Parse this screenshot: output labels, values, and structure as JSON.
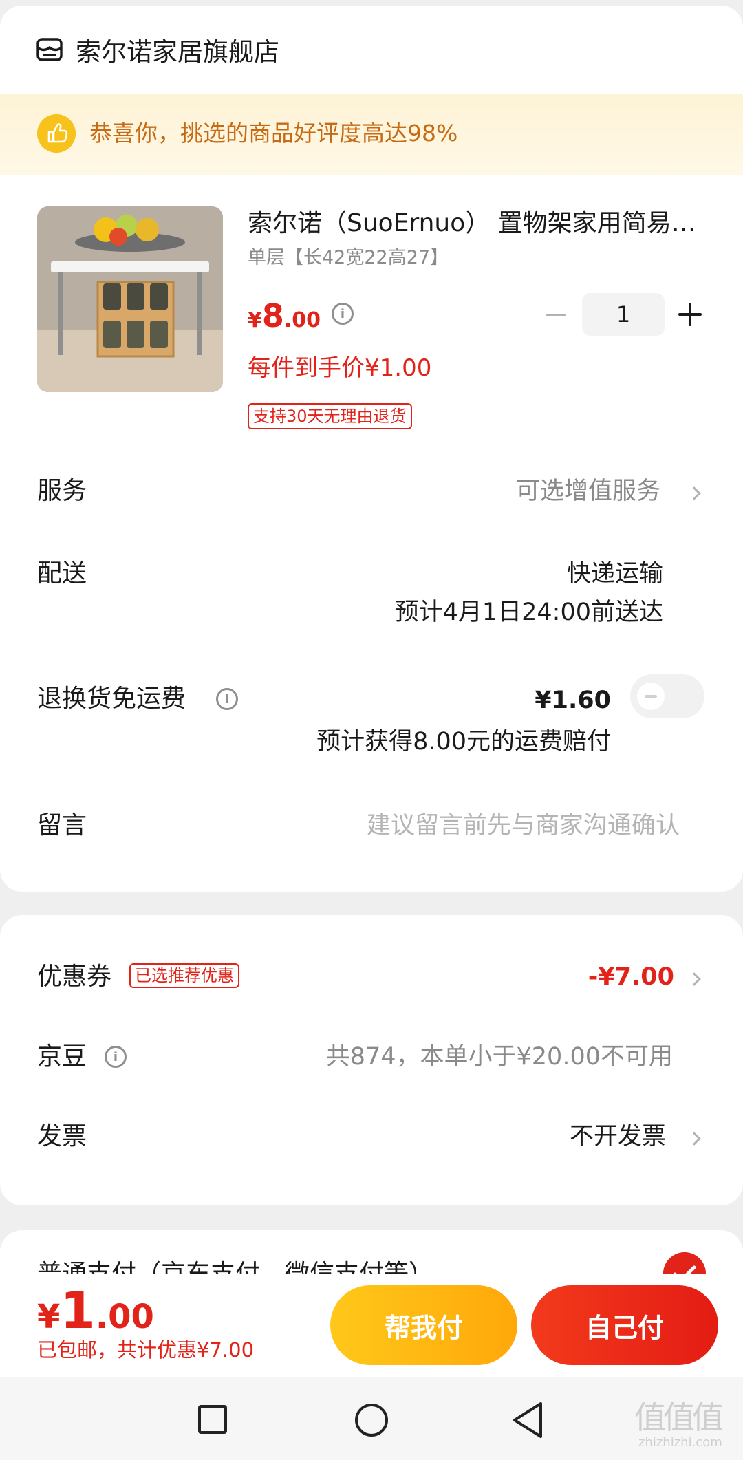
{
  "shop": {
    "icon": "store-icon",
    "name": "索尔诺家居旗舰店"
  },
  "banner": {
    "icon": "thumbs-up-icon",
    "text": "恭喜你，挑选的商品好评度高达98%"
  },
  "product": {
    "title": "索尔诺（SuoErnuo） 置物架家用简易桌面小型多层收纳架",
    "spec": "单层【长42宽22高27】",
    "price_symbol": "¥",
    "price_int": "8",
    "price_dec": ".00",
    "per_item_price": "每件到手价¥1.00",
    "return_tag": "支持30天无理由退货",
    "quantity": "1"
  },
  "service": {
    "label": "服务",
    "value": "可选增值服务"
  },
  "delivery": {
    "label": "配送",
    "method": "快递运输",
    "eta": "预计4月1日24:00前送达"
  },
  "return_shipping": {
    "label": "退换货免运费",
    "price": "¥1.60",
    "note": "预计获得8.00元的运费赔付",
    "enabled": false
  },
  "message": {
    "label": "留言",
    "placeholder": "建议留言前先与商家沟通确认"
  },
  "coupon": {
    "label": "优惠券",
    "tag": "已选推荐优惠",
    "value": "-¥7.00"
  },
  "jingdou": {
    "label": "京豆",
    "value": "共874，本单小于¥20.00不可用"
  },
  "invoice": {
    "label": "发票",
    "value": "不开发票"
  },
  "payment": {
    "title": "普通支付（京东支付、微信支付等）"
  },
  "bottom": {
    "total_symbol": "¥",
    "total_int": "1",
    "total_dec": ".00",
    "shipping_free": "已包邮",
    "discount_note": "，共计优惠¥7.00",
    "friend_pay": "帮我付",
    "self_pay": "自己付"
  },
  "watermark": {
    "text": "值值值",
    "domain": "zhizhizhi.com"
  },
  "colors": {
    "accent_red": "#e2231a",
    "banner_text": "#c76a13",
    "friend_pay_yellow": "#ffb812"
  }
}
